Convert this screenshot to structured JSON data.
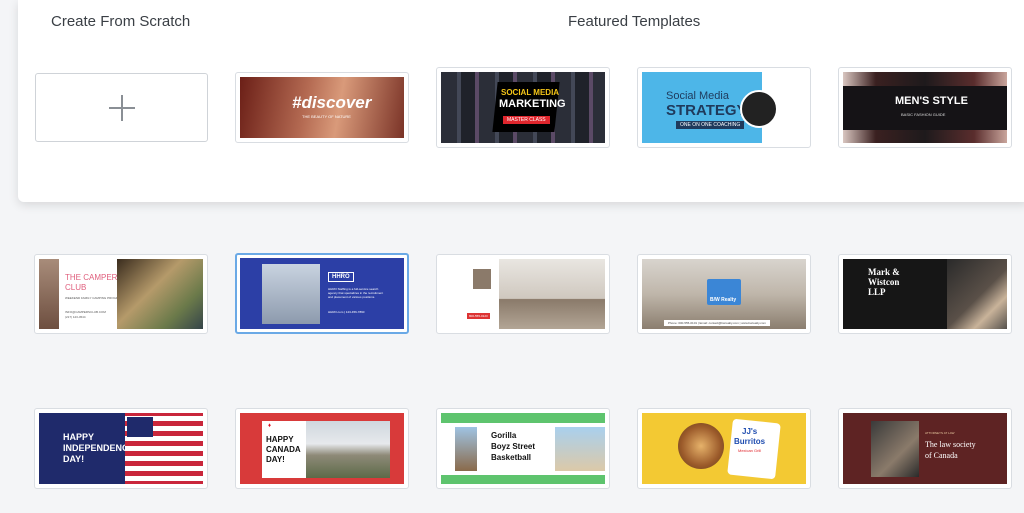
{
  "headings": {
    "create_from_scratch": "Create From Scratch",
    "featured_templates": "Featured Templates"
  },
  "templates": {
    "discover": {
      "title": "#discover",
      "tagline": "THE BEAUTY OF NATURE"
    },
    "social_marketing": {
      "line1": "SOCIAL MEDIA",
      "line2": "MARKETING",
      "badge": "MASTER CLASS"
    },
    "social_strategy": {
      "line1": "Social Media",
      "line2": "STRATEGY",
      "badge": "ONE ON ONE COACHING"
    },
    "mens_style": {
      "title": "MEN'S STYLE",
      "subtitle": "BASIC FASHION GUIDE"
    },
    "campers": {
      "title_line1": "THE CAMPERS",
      "title_line2": "CLUB",
      "subtitle": "WEEKEND FAMILY CAMPING PROGRAMS",
      "info": "INFO@CAMPERSCLUB.COM",
      "phone": "(217) 123-4544"
    },
    "hhro": {
      "logo": "HHRO",
      "body": "HHRO Staffing is a full-service search agency that specializes in the recruitment and placement of various positions.",
      "contact": "HHRO.com | 123-456-7890"
    },
    "realtor": {
      "badge": "800-555-0123"
    },
    "bw_realty": {
      "name": "B/W Realty",
      "footer": "Phone: 000-555-0101  |  Email: contact@bwrealty.com  |  www.bwrealty.com"
    },
    "mark_wistcon": {
      "line1": "Mark &",
      "line2": "Wistcon",
      "line3": "LLP"
    },
    "independence": {
      "line1": "HAPPY",
      "line2": "INDEPENDENCE",
      "line3": "DAY!"
    },
    "canada": {
      "line1": "HAPPY",
      "line2": "CANADA",
      "line3": "DAY!"
    },
    "gorilla": {
      "line1": "Gorilla",
      "line2": "Boyz Street",
      "line3": "Basketball"
    },
    "burritos": {
      "line1": "JJ's",
      "line2": "Burritos",
      "tagline": "Mexican Grill"
    },
    "law": {
      "kicker": "ATTORNEYS AT LAW",
      "line1": "The law society",
      "line2": "of Canada"
    }
  },
  "colors": {
    "panel_bg": "#ffffff",
    "page_bg": "#f4f5f7",
    "selected_border": "#6aa9e6",
    "heading_text": "#3a3f45"
  }
}
